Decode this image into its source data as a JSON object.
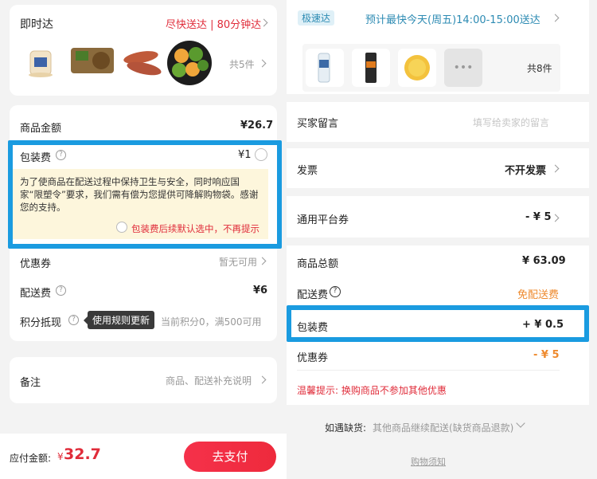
{
  "left": {
    "delivery": {
      "title": "即时达",
      "promise": "尽快送达 | 80分钟达",
      "count": "共5件"
    },
    "rows": {
      "goods_amount_label": "商品金额",
      "goods_amount_value": "¥26.7",
      "packaging_label": "包装费",
      "packaging_value": "¥1",
      "packaging_notice": "为了使商品在配送过程中保持卫生与安全，同时响应国家“限塑令”要求，我们需有偿为您提供可降解购物袋。感谢您的支持。",
      "packaging_default_opt": "包装费后续默认选中，不再提示",
      "coupon_label": "优惠券",
      "coupon_value": "暂无可用",
      "delivery_fee_label": "配送费",
      "delivery_fee_value": "¥6",
      "points_label": "积分抵现",
      "points_tooltip": "使用规则更新",
      "points_value": "当前积分0，满500可用"
    },
    "remark": {
      "label": "备注",
      "placeholder": "商品、配送补充说明"
    },
    "footer": {
      "total_label": "应付金额:",
      "total_currency": "¥",
      "total_value": "32.7",
      "pay_button": "去支付"
    }
  },
  "right": {
    "delivery": {
      "badge": "极速达",
      "eta": "预计最快今天(周五)14:00-15:00送达",
      "count": "共8件",
      "more": "•••"
    },
    "rows": {
      "message_label": "买家留言",
      "message_placeholder": "填写给卖家的留言",
      "invoice_label": "发票",
      "invoice_value": "不开发票",
      "platform_coupon_label": "通用平台券",
      "platform_coupon_value": "- ¥ 5",
      "total_label": "商品总额",
      "total_value": "¥ 63.09",
      "shipping_label": "配送费",
      "shipping_value": "免配送费",
      "packaging_label": "包装费",
      "packaging_value": "+ ¥ 0.5",
      "coupon_label": "优惠券",
      "coupon_value": "- ¥ 5",
      "tip": "温馨提示: 换购商品不参加其他优惠",
      "stockout_label": "如遇缺货:",
      "stockout_value": "其他商品继续配送(缺货商品退款)",
      "notice_link": "购物须知"
    }
  },
  "colors": {
    "accent_red": "#e02c3a",
    "highlight_blue": "#1a9be0",
    "orange": "#ee8a2e",
    "teal": "#2d8bb3"
  }
}
